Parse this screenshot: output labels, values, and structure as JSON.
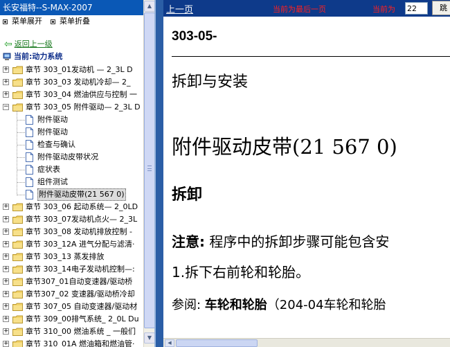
{
  "left": {
    "title": "长安福特--S-MAX-2007",
    "menu_expand": "菜单展开",
    "menu_collapse": "菜单折叠",
    "back_link": "返回上一级",
    "current_label": "当前:动力系统"
  },
  "tree": {
    "chapters_before": [
      "章节  303_01发动机 — 2_3L D",
      "章节  303_03 发动机冷却— 2_",
      "章节  303_04 燃油供应与控制 一"
    ],
    "open_chapter": "章节  303_05 附件驱动— 2_3L D",
    "children": [
      "附件驱动",
      "附件驱动",
      "检查与确认",
      "附件驱动皮带状况",
      "症状表",
      "组件测试",
      "附件驱动皮带(21 567 0)"
    ],
    "selected_index": 6,
    "chapters_after": [
      "章节  303_06 起动系统— 2_0LD",
      "章节  303_07发动机点火— 2_3L",
      "章节  303_08 发动机排放控制 -",
      "章节  303_12A 进气分配与滤清·",
      "章节  303_13 蒸发排放",
      "章节  303_14电子发动机控制—:",
      "章节307_01自动变速器/驱动桥",
      "章节307_02 变速器/驱动桥冷却",
      "章节  307_05 自动变速器/驱动材",
      "章节  309_00排气系统_ 2_0L Du",
      "章节  310_00 燃油系统  _ 一般们",
      "章节  310_01A 燃油箱和燃油管·"
    ]
  },
  "nav": {
    "prev": "上一页",
    "last_page_msg": "当前为最后一页",
    "current_label": "当前为",
    "page_value": "22",
    "jump_label": "跳"
  },
  "doc": {
    "code": "303-05-",
    "section": "拆卸与安装",
    "title": "附件驱动皮带(21 567 0)",
    "removal": "拆卸",
    "note_label": "注意:",
    "note_text": " 程序中的拆卸步骤可能包含安",
    "step1": "1.拆下右前轮和轮胎。",
    "ref_prefix": "参阅: ",
    "ref_bold": "车轮和轮胎",
    "ref_rest": "（204-04车轮和轮胎"
  },
  "colors": {
    "title_bar": "#0a58b6",
    "nav_bar": "#0e3a8a",
    "splitter": "#2b5ea6",
    "alert_red": "#ff2020",
    "back_green": "#1a7a20",
    "current_navy": "#0d2d8a",
    "folder_yellow": "#f3d469"
  }
}
